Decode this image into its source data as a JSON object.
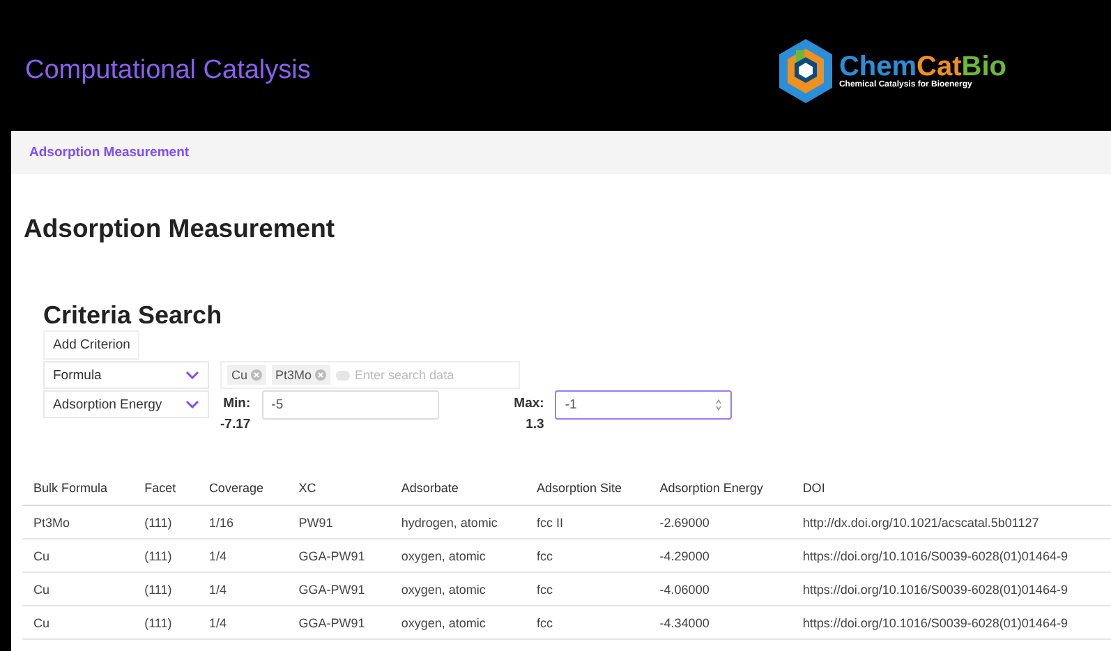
{
  "header": {
    "title": "Computational Catalysis",
    "logo": {
      "name_parts": [
        {
          "text": "Chem",
          "color": "#2a8fd8"
        },
        {
          "text": "Cat",
          "color": "#f0901e"
        },
        {
          "text": "Bio",
          "color": "#6cb83a"
        }
      ],
      "tagline": "Chemical Catalysis for Bioenergy"
    }
  },
  "breadcrumb": "Adsorption Measurement",
  "page_title": "Adsorption Measurement",
  "criteria": {
    "title": "Criteria Search",
    "add_button": "Add Criterion",
    "rows": [
      {
        "kind": "tags",
        "field": "Formula",
        "tags": [
          "Cu",
          "Pt3Mo"
        ],
        "placeholder": "Enter search data"
      },
      {
        "kind": "range",
        "field": "Adsorption Energy",
        "min_label": "Min:",
        "min_bound": "-7.17",
        "min_value": "-5",
        "max_label": "Max:",
        "max_bound": "1.3",
        "max_value": "-1",
        "min_focused": false,
        "max_focused": true
      }
    ]
  },
  "table": {
    "columns": [
      "Bulk Formula",
      "Facet",
      "Coverage",
      "XC",
      "Adsorbate",
      "Adsorption Site",
      "Adsorption Energy",
      "DOI"
    ],
    "rows": [
      [
        "Pt3Mo",
        "(111)",
        "1/16",
        "PW91",
        "hydrogen, atomic",
        "fcc II",
        "-2.69000",
        "http://dx.doi.org/10.1021/acscatal.5b01127"
      ],
      [
        "Cu",
        "(111)",
        "1/4",
        "GGA-PW91",
        "oxygen, atomic",
        "fcc",
        "-4.29000",
        "https://doi.org/10.1016/S0039-6028(01)01464-9"
      ],
      [
        "Cu",
        "(111)",
        "1/4",
        "GGA-PW91",
        "oxygen, atomic",
        "fcc",
        "-4.06000",
        "https://doi.org/10.1016/S0039-6028(01)01464-9"
      ],
      [
        "Cu",
        "(111)",
        "1/4",
        "GGA-PW91",
        "oxygen, atomic",
        "fcc",
        "-4.34000",
        "https://doi.org/10.1016/S0039-6028(01)01464-9"
      ]
    ]
  }
}
